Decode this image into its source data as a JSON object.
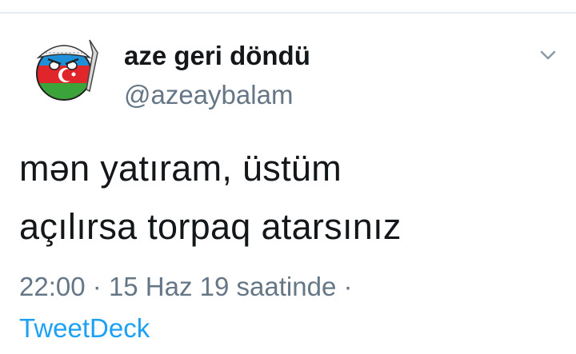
{
  "tweet": {
    "author_name": "aze geri döndü",
    "handle": "@azeaybalam",
    "text_line1": "mən yatıram, üstüm",
    "text_line2": "açılırsa torpaq atarsınız",
    "time": "22:00",
    "date": "15 Haz 19 saatinde",
    "source": "TweetDeck",
    "separator": "·"
  },
  "icons": {
    "avatar": "azerbaijan-countryball-avatar",
    "menu": "chevron-down-icon"
  },
  "colors": {
    "text": "#14171a",
    "secondary": "#657786",
    "link": "#1da1f2",
    "flag_blue": "#1e90d8",
    "flag_red": "#e0252b",
    "flag_green": "#3ca33a"
  }
}
